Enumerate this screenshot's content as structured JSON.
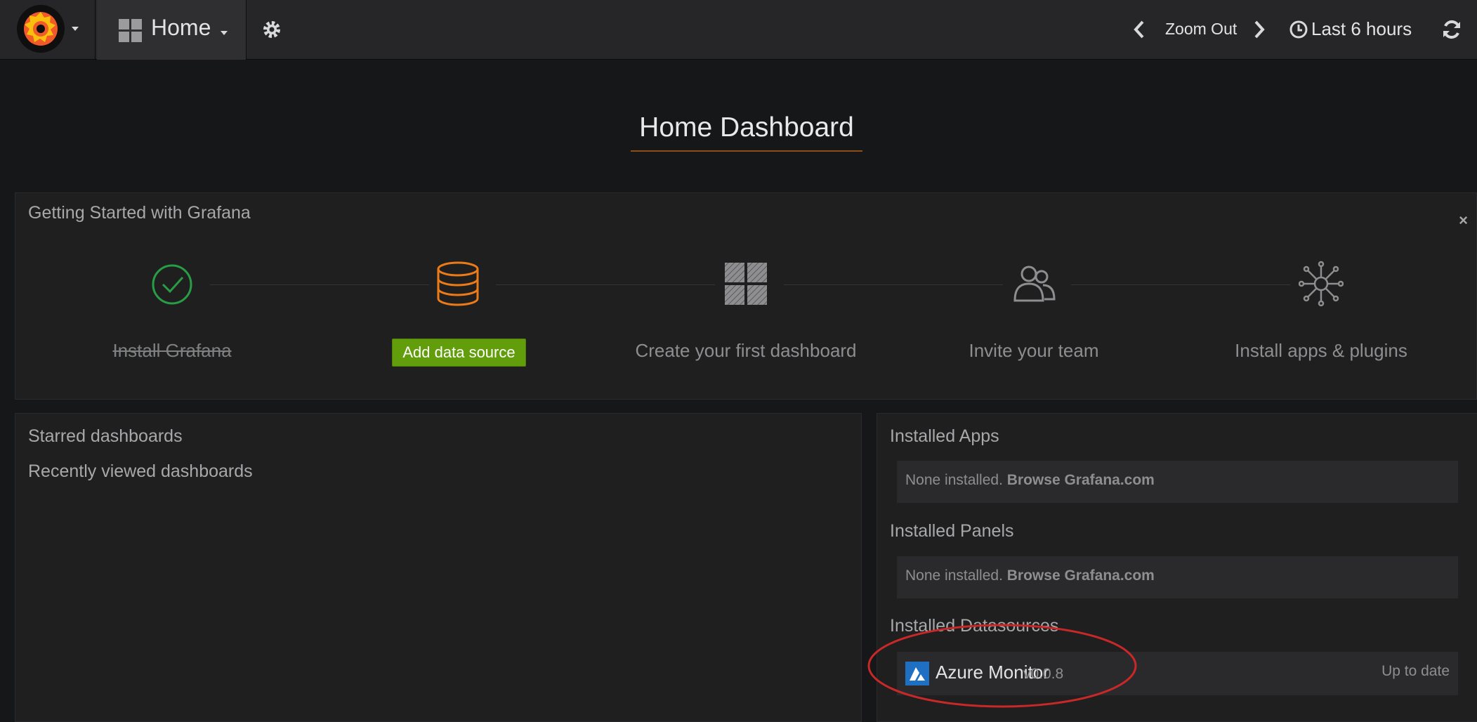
{
  "navbar": {
    "home_label": "Home",
    "zoom_label": "Zoom Out",
    "time_range": "Last 6 hours"
  },
  "dashboard": {
    "title": "Home Dashboard"
  },
  "getting_started": {
    "title": "Getting Started with Grafana",
    "close": "×",
    "steps": [
      {
        "label": "Install Grafana",
        "state": "done"
      },
      {
        "label": "Add data source",
        "state": "active"
      },
      {
        "label": "Create your first dashboard",
        "state": "todo"
      },
      {
        "label": "Invite your team",
        "state": "todo"
      },
      {
        "label": "Install apps & plugins",
        "state": "todo"
      }
    ]
  },
  "left_panel": {
    "starred": "Starred dashboards",
    "recent": "Recently viewed dashboards"
  },
  "plugins": {
    "apps_title": "Installed Apps",
    "apps_none": "None installed.",
    "apps_link": "Browse Grafana.com",
    "panels_title": "Installed Panels",
    "panels_none": "None installed.",
    "panels_link": "Browse Grafana.com",
    "datasources_title": "Installed Datasources",
    "datasource": {
      "name": "Azure Monitor",
      "version": "v0.0.8",
      "status": "Up to date"
    }
  },
  "colors": {
    "accent_orange": "#eb7b18",
    "success_green": "#299c46",
    "button_green": "#629e0c",
    "azure_blue": "#1f6fc2",
    "annotation_red": "#c82828"
  },
  "icons": [
    "grafana-logo-icon",
    "dashboard-grid-icon",
    "gear-icon",
    "chevron-left-icon",
    "chevron-right-icon",
    "clock-icon",
    "refresh-icon",
    "check-circle-icon",
    "database-icon",
    "dashboard-squares-icon",
    "users-icon",
    "plugins-icon",
    "azure-icon"
  ]
}
